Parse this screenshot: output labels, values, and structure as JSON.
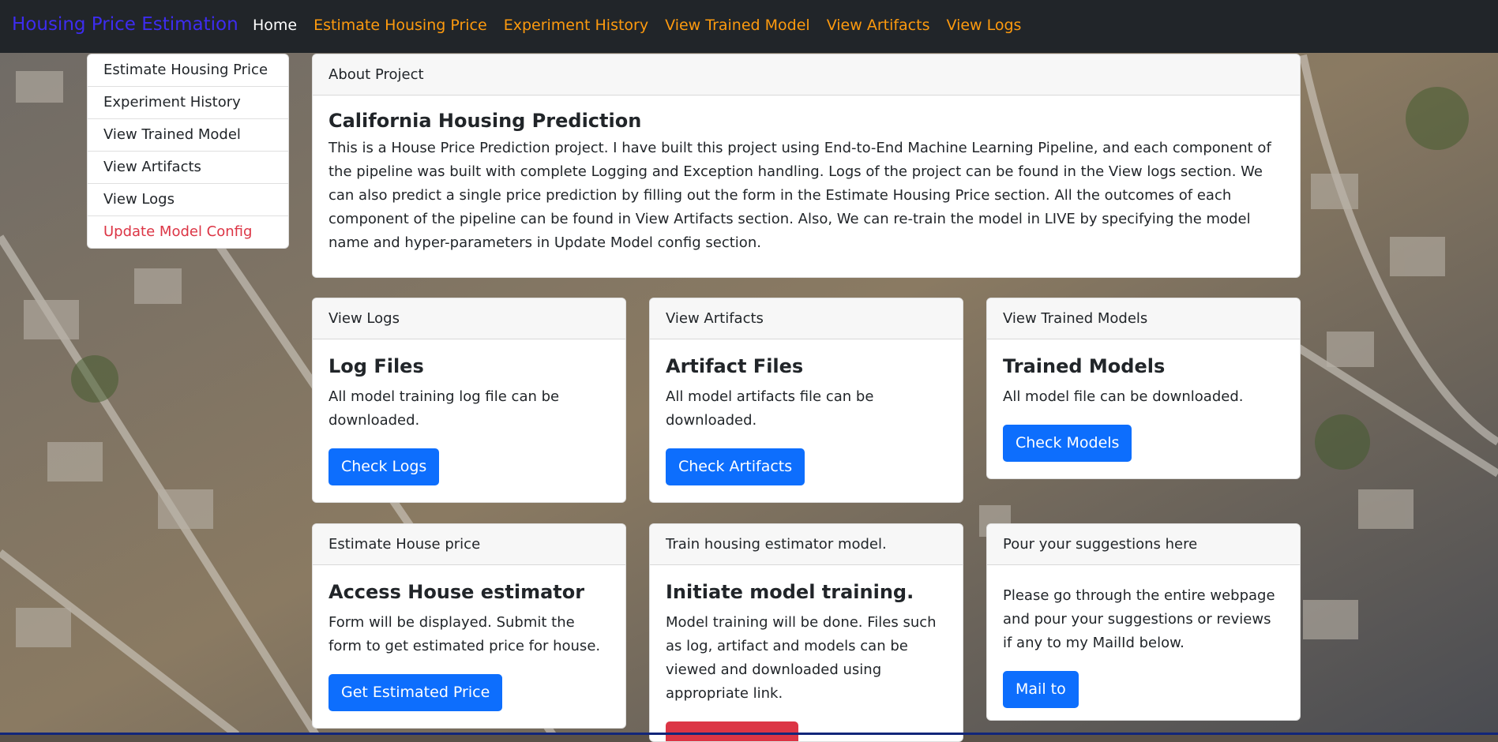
{
  "navbar": {
    "brand": "Housing Price Estimation",
    "links": [
      "Home",
      "Estimate Housing Price",
      "Experiment History",
      "View Trained Model",
      "View Artifacts",
      "View Logs"
    ]
  },
  "sidebar": {
    "items": [
      "Estimate Housing Price",
      "Experiment History",
      "View Trained Model",
      "View Artifacts",
      "View Logs",
      "Update Model Config"
    ]
  },
  "about": {
    "header": "About Project",
    "title": "California Housing Prediction",
    "text": "This is a House Price Prediction project. I have built this project using End-to-End Machine Learning Pipeline, and each component of the pipeline was built with complete Logging and Exception handling. Logs of the project can be found in the View logs section. We can also predict a single price prediction by filling out the form in the Estimate Housing Price section. All the outcomes of each component of the pipeline can be found in View Artifacts section. Also, We can re-train the model in LIVE by specifying the model name and hyper-parameters in Update Model config section."
  },
  "cards": {
    "logs": {
      "header": "View Logs",
      "title": "Log Files",
      "text": "All model training log file can be downloaded.",
      "button": "Check Logs"
    },
    "artifacts": {
      "header": "View Artifacts",
      "title": "Artifact Files",
      "text": "All model artifacts file can be downloaded.",
      "button": "Check Artifacts"
    },
    "models": {
      "header": "View Trained Models",
      "title": "Trained Models",
      "text": "All model file can be downloaded.",
      "button": "Check Models"
    },
    "estimate": {
      "header": "Estimate House price",
      "title": "Access House estimator",
      "text": "Form will be displayed. Submit the form to get estimated price for house.",
      "button": "Get Estimated Price"
    },
    "train": {
      "header": "Train housing estimator model.",
      "title": "Initiate model training.",
      "text": "Model training will be done. Files such as log, artifact and models can be viewed and downloaded using appropriate link.",
      "button": ""
    },
    "suggest": {
      "header": "Pour your suggestions here",
      "title": "",
      "text": "Please go through the entire webpage and pour your suggestions or reviews if any to my MailId below.",
      "button": "Mail to"
    }
  },
  "colors": {
    "navbar_bg": "#212529",
    "brand": "#3d2cf0",
    "nav_link": "#fd9a0e",
    "primary_button": "#0d6efd",
    "danger": "#dc3545"
  }
}
